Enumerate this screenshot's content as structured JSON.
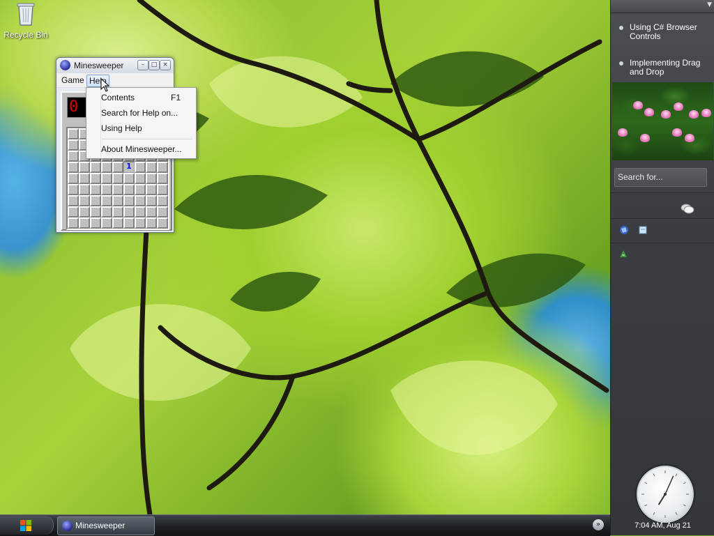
{
  "desktop": {
    "icons": [
      {
        "label": "Recycle Bin",
        "icon": "recycle-bin-icon"
      }
    ]
  },
  "window": {
    "title": "Minesweeper",
    "controls": {
      "minimize": "–",
      "maximize": "□",
      "close": "×"
    },
    "menu": {
      "game": "Game",
      "help": "Help"
    },
    "counter": "0",
    "board": {
      "rows": 9,
      "cols": 9,
      "revealed": [
        {
          "row": 3,
          "col": 5,
          "value": "1"
        }
      ]
    }
  },
  "help_menu": {
    "items": [
      {
        "label": "Contents",
        "shortcut": "F1"
      },
      {
        "label": "Search for Help on...",
        "shortcut": ""
      },
      {
        "label": "Using Help",
        "shortcut": ""
      },
      {
        "label": "About Minesweeper...",
        "shortcut": ""
      }
    ]
  },
  "sidebar": {
    "feeds": [
      {
        "title": "Using C# Browser Controls"
      },
      {
        "title": "Implementing Drag and Drop"
      }
    ],
    "search_placeholder": "Search for...",
    "clock_label": "7:04 AM, Aug 21",
    "clock_time": {
      "hour": 7,
      "minute": 4
    }
  },
  "taskbar": {
    "tasks": [
      {
        "label": "Minesweeper",
        "icon": "minesweeper-icon"
      }
    ]
  },
  "colors": {
    "counter_digits": "#e00000",
    "number_one": "#0000ff",
    "menu_highlight": "#cfe1f6"
  }
}
